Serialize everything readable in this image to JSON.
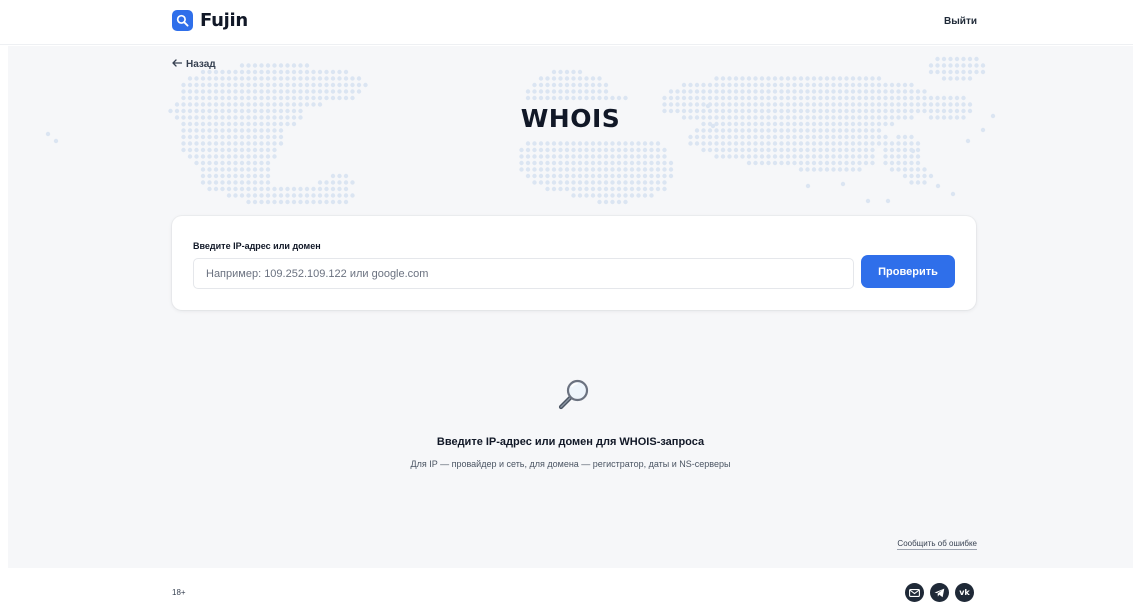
{
  "header": {
    "brand": "Fujin",
    "logout_label": "Выйти"
  },
  "nav": {
    "back_label": "Назад"
  },
  "page": {
    "title": "WHOIS"
  },
  "search": {
    "label": "Введите IP-адрес или домен",
    "placeholder": "Например: 109.252.109.122 или google.com",
    "value": "",
    "submit_label": "Проверить"
  },
  "empty_state": {
    "icon": "magnifier-icon",
    "title": "Введите IP-адрес или домен для WHOIS-запроса",
    "subtitle": "Для IP — провайдер и сеть, для домена — регистратор, даты и NS-серверы"
  },
  "report_link": "Сообщить об ошибке",
  "footer": {
    "age_rating": "18+",
    "socials": [
      {
        "icon": "email-icon"
      },
      {
        "icon": "telegram-icon"
      },
      {
        "icon": "vk-icon",
        "glyph": "vk"
      }
    ]
  },
  "colors": {
    "accent": "#2f6fea",
    "background": "#f6f7f9",
    "map_dots": "#dbe5f2",
    "text": "#111827"
  }
}
